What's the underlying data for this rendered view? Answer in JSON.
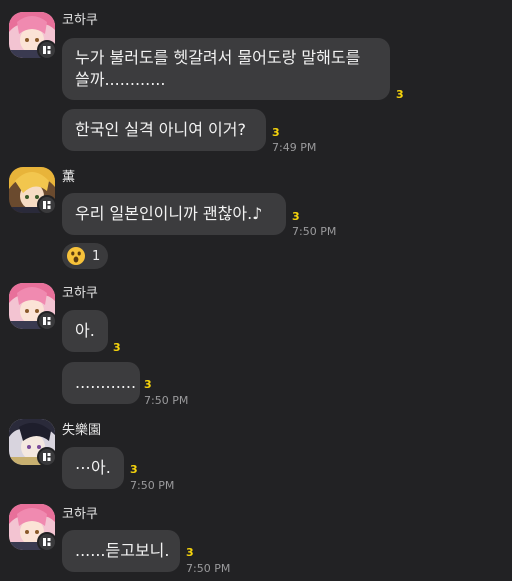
{
  "colors": {
    "background": "#222224",
    "bubble": "#3c3c3e",
    "unread": "#f5d30c",
    "time": "#9a9a9c"
  },
  "senders": {
    "kohaku": "코하쿠",
    "kaoru": "薫",
    "rakuen": "失樂園"
  },
  "messages": [
    {
      "text": "누가 불러도를 헷갈려서 물어도랑 말해도를",
      "text2": "쓸까............",
      "unread": "3"
    },
    {
      "text": "한국인 실격 아니여 이거?",
      "unread": "3",
      "time": "7:49 PM"
    },
    {
      "text": "우리 일본인이니까 괜찮아.♪",
      "unread": "3",
      "time": "7:50 PM"
    },
    {
      "text": "아.",
      "unread": "3"
    },
    {
      "text": "............",
      "unread": "3",
      "time": "7:50 PM"
    },
    {
      "text": "⋯아.",
      "unread": "3",
      "time": "7:50 PM"
    },
    {
      "text": "......듣고보니.",
      "unread": "3",
      "time": "7:50 PM"
    }
  ],
  "reaction": {
    "icon": "surprised-face-icon",
    "count": "1"
  },
  "icons": {
    "badge": "apps-badge-icon"
  }
}
